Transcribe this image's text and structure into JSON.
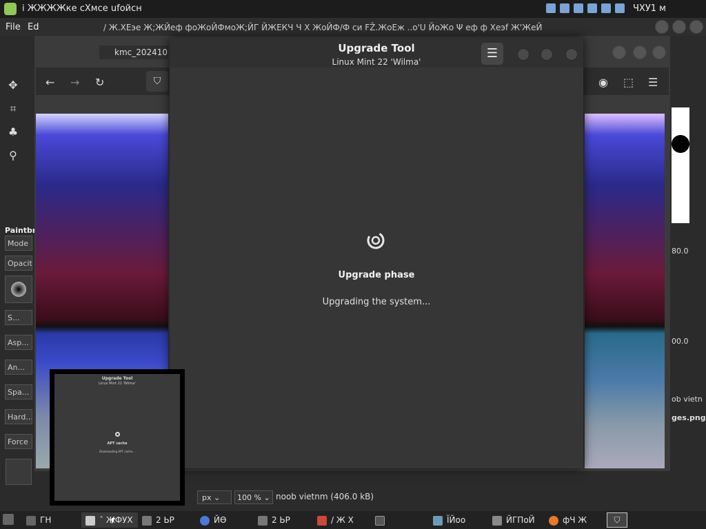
{
  "top_panel": {
    "title": "i ЖЖЖЖке  сХмсе  ufoйсн",
    "clock": "ЧХУ1 м"
  },
  "gimp": {
    "menu": [
      "File",
      "Ed"
    ],
    "marquee": "/ Ж.ХЕэе  Ж;ЖЙеф     фоЖоЙФмоЖ;ЙГ     ЙЖЕКЧ Ч Х ЖоЙФ/Ф си FŽ.ЖоЕж ..о'U     ЙоЖо        Ψ          еф ф Хеэf Ж'ЖеЙ",
    "image_tab": "kmc_202410",
    "tool_options": {
      "title": "Paintbr",
      "mode": "Mode",
      "opacity": "Opacity",
      "size": "S...",
      "aspect": "Asp...",
      "angle": "An...",
      "spacing": "Spa...",
      "hardness": "Hard...",
      "force": "Force"
    },
    "right_dock": {
      "value1": "80.0",
      "value2": "00.0",
      "file1": "ob vietn",
      "file2": "ges.png"
    },
    "status": {
      "unit": "px",
      "zoom": "100 %",
      "file_info": "noob vietnm (406.0 kB)"
    }
  },
  "dialog": {
    "title": "Upgrade Tool",
    "subtitle": "Linux Mint 22 'Wilma'",
    "phase": "Upgrade phase",
    "message": "Upgrading the system...",
    "menu_glyph": "☰"
  },
  "preview": {
    "title": "Upgrade Tool",
    "subtitle": "Linux Mint 22 'Wilma'",
    "phase": "APT cache",
    "message": "Downloading APT cache..."
  },
  "taskbar": {
    "items": [
      {
        "label": "ГН"
      },
      {
        "label": "ˆ ЖФУХ"
      },
      {
        "label": "2 ЬР"
      },
      {
        "label": "ЙӨ"
      },
      {
        "label": "2 ЬР"
      },
      {
        "label": "/ Ж Х"
      },
      {
        "label": "ЇЙоо"
      },
      {
        "label": "ЙГПоЙ"
      },
      {
        "label": "фЧ Ж"
      }
    ]
  },
  "colors": {
    "panel": "#1c1c1c",
    "dialog_bg": "#363636",
    "mint_green": "#8fc857"
  }
}
